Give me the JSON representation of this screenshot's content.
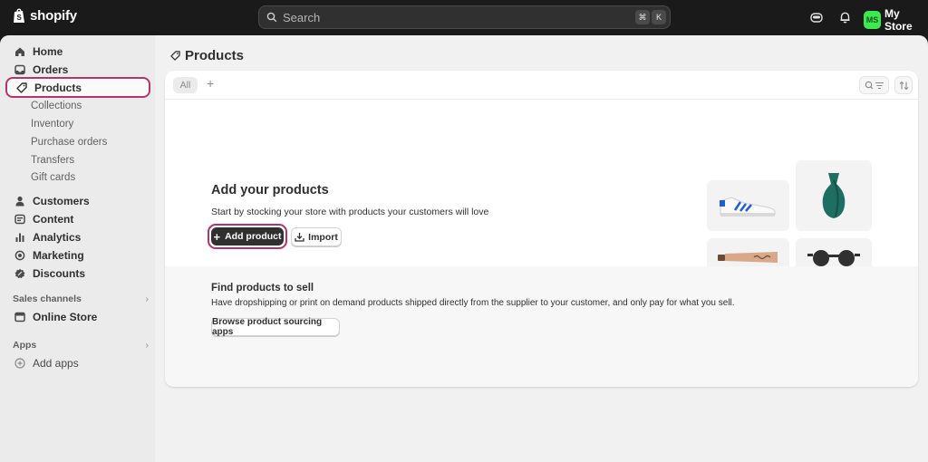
{
  "topbar": {
    "brand": "shopify",
    "search_placeholder": "Search",
    "shortcut_cmd": "⌘",
    "shortcut_key": "K",
    "store_initials": "MS",
    "store_name": "My Store"
  },
  "sidebar": {
    "items": [
      {
        "label": "Home",
        "icon": "home-icon"
      },
      {
        "label": "Orders",
        "icon": "inbox-icon"
      },
      {
        "label": "Products",
        "icon": "tag-icon"
      }
    ],
    "product_subitems": [
      "Collections",
      "Inventory",
      "Purchase orders",
      "Transfers",
      "Gift cards"
    ],
    "items2": [
      {
        "label": "Customers",
        "icon": "person-icon"
      },
      {
        "label": "Content",
        "icon": "content-icon"
      },
      {
        "label": "Analytics",
        "icon": "bar-chart-icon"
      },
      {
        "label": "Marketing",
        "icon": "target-icon"
      },
      {
        "label": "Discounts",
        "icon": "discount-icon"
      }
    ],
    "sales_channels_label": "Sales channels",
    "online_store": "Online Store",
    "apps_label": "Apps",
    "add_apps": "Add apps"
  },
  "page": {
    "title": "Products"
  },
  "filters": {
    "tab_all": "All",
    "add_tab": "+"
  },
  "empty_state": {
    "heading": "Add your products",
    "description": "Start by stocking your store with products your customers will love",
    "add_button": "Add product",
    "import_button": "Import"
  },
  "find_products": {
    "heading": "Find products to sell",
    "description": "Have dropshipping or print on demand products shipped directly from the supplier to your customer, and only pay for what you sell.",
    "button": "Browse product sourcing apps"
  },
  "colors": {
    "highlight": "#b8326e",
    "avatar": "#3ee850",
    "vase": "#1f6e62"
  }
}
